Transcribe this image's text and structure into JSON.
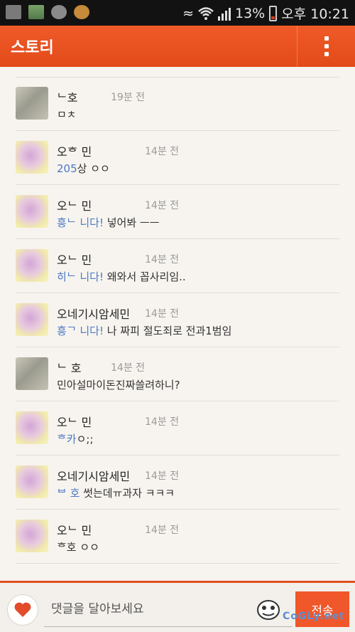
{
  "status_bar": {
    "battery": "13%",
    "clock": "오후 10:21",
    "icons": [
      "gallery-icon",
      "storage-icon",
      "steam-icon",
      "teddy-bear-icon",
      "vibrate-icon",
      "wifi-icon",
      "signal-icon",
      "battery-icon"
    ]
  },
  "app_bar": {
    "title": "스토리",
    "menu_icon": "overflow-menu-icon"
  },
  "comments": [
    {
      "name": "ᄂ호",
      "time": "19분 전",
      "mention": "",
      "text": "ㅁㅊ",
      "avatar": "a"
    },
    {
      "name": "오ᄒ 민",
      "time": "14분 전",
      "mention": "205",
      "text": "상 ㅇㅇ",
      "avatar": "b"
    },
    {
      "name": "오ᄂ 민",
      "time": "14분 전",
      "mention": "흥ᄂ 니다!",
      "text": " 넣어봐 ㅡㅡ",
      "avatar": "b"
    },
    {
      "name": "오ᄂ 민",
      "time": "14분 전",
      "mention": "히ᄂ 니다!",
      "text": " 왜와서 꼽사리임..",
      "avatar": "b"
    },
    {
      "name": "오네기시암세민",
      "time": "14분 전",
      "mention": "흥ᄀ 니다!",
      "text": " 나 짜피 절도죄로 전과1범임",
      "avatar": "b"
    },
    {
      "name": "ᄂ 호",
      "time": "14분 전",
      "mention": "",
      "text": "민아설마이돈진짜쓸려하니?",
      "avatar": "a"
    },
    {
      "name": "오ᄂ 민",
      "time": "14분 전",
      "mention": "ᄒ카",
      "text": "ㅇ;;",
      "avatar": "b"
    },
    {
      "name": "오네기시암세민",
      "time": "14분 전",
      "mention": "ᄇ 호",
      "text": " 썻는데ㅠ과자 ㅋㅋㅋ",
      "avatar": "b"
    },
    {
      "name": "오ᄂ 민",
      "time": "14분 전",
      "mention": "",
      "text": "ᄒ호 ㅇㅇ",
      "avatar": "b"
    }
  ],
  "bottom_bar": {
    "heart_icon": "heart-icon",
    "input_placeholder": "댓글을 달아보세요",
    "emoticon_icon": "emoticon-icon",
    "send_label": "전송",
    "accent": "#f0572a"
  },
  "watermark": "CoGLy.net"
}
